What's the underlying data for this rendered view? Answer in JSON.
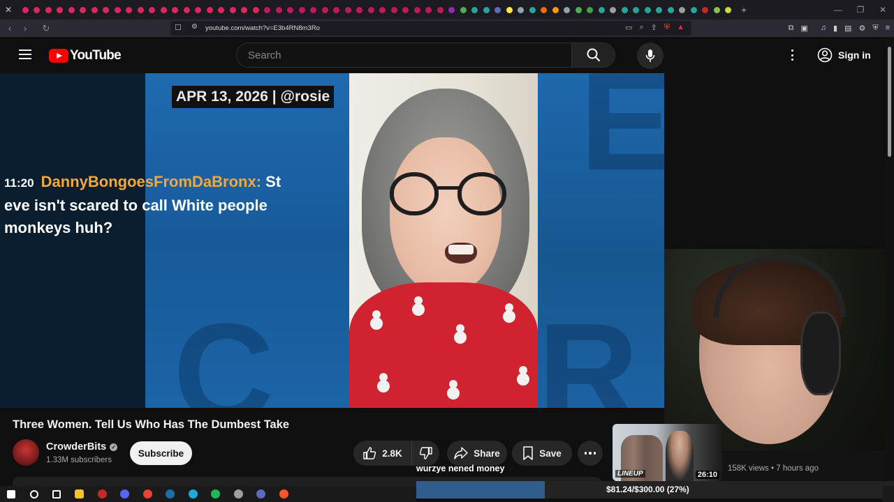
{
  "browser": {
    "url": "youtube.com/watch?v=E3b4RN8m3Ro",
    "tab_favicon_colors": [
      "#e0245e",
      "#e0245e",
      "#e0245e",
      "#e0245e",
      "#e0245e",
      "#e0245e",
      "#e0245e",
      "#e0245e",
      "#e0245e",
      "#e0245e",
      "#e0245e",
      "#e0245e",
      "#e0245e",
      "#e0245e",
      "#e0245e",
      "#e0245e",
      "#e0245e",
      "#e0245e",
      "#e0245e",
      "#e0245e",
      "#e0245e",
      "#c2185b",
      "#c2185b",
      "#c2185b",
      "#c2185b",
      "#c2185b",
      "#c2185b",
      "#c2185b",
      "#c2185b",
      "#c2185b",
      "#c2185b",
      "#c2185b",
      "#c2185b",
      "#c2185b",
      "#c2185b",
      "#c2185b",
      "#c2185b",
      "#9c27b0",
      "#4caf50",
      "#26a69a",
      "#26a69a",
      "#5c6bc0",
      "#ffeb3b",
      "#90a4ae",
      "#26a69a",
      "#ef6c00",
      "#ff9800",
      "#90a4ae",
      "#4caf50",
      "#43a047",
      "#26a69a",
      "#9e9e9e",
      "#26a69a",
      "#26a69a",
      "#26a69a",
      "#26a69a",
      "#26a69a",
      "#9e9e9e",
      "#26a69a",
      "#c62828",
      "#8bc34a",
      "#cddc39"
    ]
  },
  "header": {
    "logo_text": "YouTube",
    "search_placeholder": "Search",
    "signin_label": "Sign in"
  },
  "video": {
    "date_badge": "APR 13, 2026 | @rosie",
    "chat": {
      "time": "11:20",
      "user": "DannyBongoesFromDaBronx:",
      "message": " St eve isn't scared to call White people monkeys huh?"
    }
  },
  "details": {
    "title": "Three Women. Tell Us Who Has The Dumbest Take",
    "channel_name": "CrowderBits",
    "subscribers": "1.33M subscribers",
    "subscribe_label": "Subscribe",
    "like_count": "2.8K",
    "share_label": "Share",
    "save_label": "Save"
  },
  "stream_overlay": {
    "donation_message": "wurzye nened money",
    "goal_text": "$81.24/$300.00 (27%)",
    "goal_progress": 0.27
  },
  "recommendation": {
    "thumb_label": "LINEUP",
    "duration": "26:10",
    "meta": "158K views • 7 hours ago"
  },
  "taskbar": {
    "icons": [
      {
        "name": "windows-start-icon",
        "color": "#ffffff"
      },
      {
        "name": "search-icon",
        "color": "#ffffff"
      },
      {
        "name": "task-view-icon",
        "color": "#ffffff"
      },
      {
        "name": "file-explorer-icon",
        "color": "#f4c430"
      },
      {
        "name": "obs-icon",
        "color": "#c62828"
      },
      {
        "name": "discord-icon",
        "color": "#5865f2"
      },
      {
        "name": "chrome-icon",
        "color": "#e94235"
      },
      {
        "name": "steam-icon",
        "color": "#1b6ea8"
      },
      {
        "name": "edge-icon",
        "color": "#1fa8d8"
      },
      {
        "name": "spotify-icon",
        "color": "#1db954"
      },
      {
        "name": "app-icon",
        "color": "#9e9e9e"
      },
      {
        "name": "app2-icon",
        "color": "#5c6bc0"
      },
      {
        "name": "brave-icon",
        "color": "#fb542b"
      }
    ]
  }
}
